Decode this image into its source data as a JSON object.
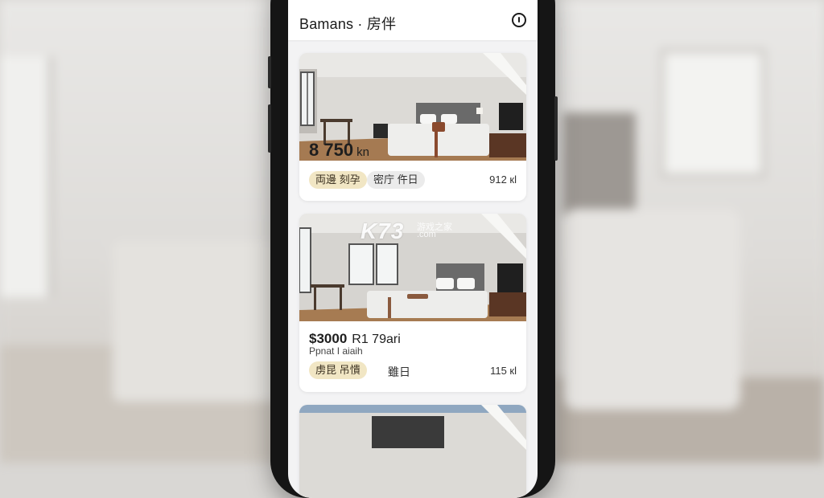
{
  "app": {
    "title": "Bamans · 房伴"
  },
  "listings": [
    {
      "price": "8 750",
      "price_unit": "kn",
      "tags": [
        "両邊 刻孕",
        "密庁 仵日"
      ],
      "meta": "912 кl"
    },
    {
      "price": "$3000",
      "price_rest": "R1 79ari",
      "subtitle": "Ppnat I aiaih",
      "tags": [
        "虏昆 吊憒"
      ],
      "extra": "雖日",
      "meta": "115 кl"
    }
  ],
  "watermark": {
    "main": "K73",
    "cn": "游戏之家",
    "domain": ".com"
  },
  "colors": {
    "tag_gold": "#f1e6c4",
    "tag_grey": "#ebebeb",
    "phone_body": "#151515",
    "screen_bg": "#f3f3f4"
  }
}
